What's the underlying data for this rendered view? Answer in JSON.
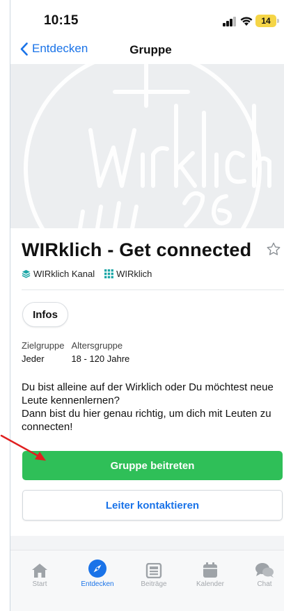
{
  "status_bar": {
    "time": "10:15",
    "battery": "14"
  },
  "nav": {
    "back_label": "Entdecken",
    "title": "Gruppe"
  },
  "hero": {
    "logo_text": "Wirklich",
    "logo_number": "26"
  },
  "group": {
    "title": "WIRklich - Get connected",
    "tags": [
      {
        "label": "WIRklich Kanal",
        "icon": "layers-icon"
      },
      {
        "label": "WIRklich",
        "icon": "grid-icon"
      }
    ],
    "infos_label": "Infos",
    "meta": {
      "audience_label": "Zielgruppe",
      "audience_value": "Jeder",
      "age_label": "Altersgruppe",
      "age_value": "18 - 120 Jahre"
    },
    "description_line1": "Du bist alleine auf der Wirklich oder Du möchtest neue Leute kennenlernen?",
    "description_line2": "Dann bist du hier genau richtig, um dich mit Leuten zu connecten!",
    "join_button": "Gruppe beitreten",
    "contact_button": "Leiter kontaktieren"
  },
  "tabbar": {
    "tabs": [
      {
        "label": "Start",
        "icon": "home-icon",
        "active": false
      },
      {
        "label": "Entdecken",
        "icon": "compass-icon",
        "active": true
      },
      {
        "label": "Beiträge",
        "icon": "newspaper-icon",
        "active": false
      },
      {
        "label": "Kalender",
        "icon": "calendar-icon",
        "active": false
      },
      {
        "label": "Chat",
        "icon": "chat-icon",
        "active": false
      }
    ]
  },
  "colors": {
    "accent": "#1a73e8",
    "join_green": "#2fbf58",
    "tag_teal": "#1aa6a6",
    "annotation_red": "#e02020"
  }
}
